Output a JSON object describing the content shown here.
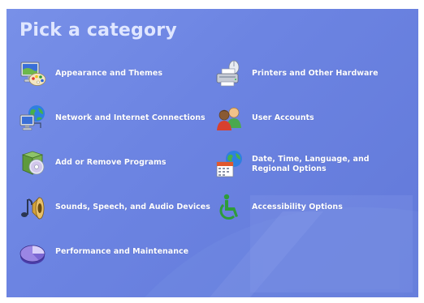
{
  "title": "Pick a category",
  "categories": [
    {
      "label": "Appearance and Themes",
      "icon": "appearance-themes-icon"
    },
    {
      "label": "Network and Internet Connections",
      "icon": "network-internet-icon"
    },
    {
      "label": "Add or Remove Programs",
      "icon": "add-remove-programs-icon"
    },
    {
      "label": "Sounds, Speech, and Audio Devices",
      "icon": "sounds-audio-icon"
    },
    {
      "label": "Performance and Maintenance",
      "icon": "performance-maintenance-icon"
    },
    {
      "label": "Printers and Other Hardware",
      "icon": "printers-hardware-icon"
    },
    {
      "label": "User Accounts",
      "icon": "user-accounts-icon"
    },
    {
      "label": "Date, Time, Language, and Regional Options",
      "icon": "date-time-regional-icon"
    },
    {
      "label": "Accessibility Options",
      "icon": "accessibility-icon"
    }
  ],
  "colors": {
    "background": "#6c84e2",
    "title": "#dfe6ff",
    "label": "#ffffff"
  }
}
